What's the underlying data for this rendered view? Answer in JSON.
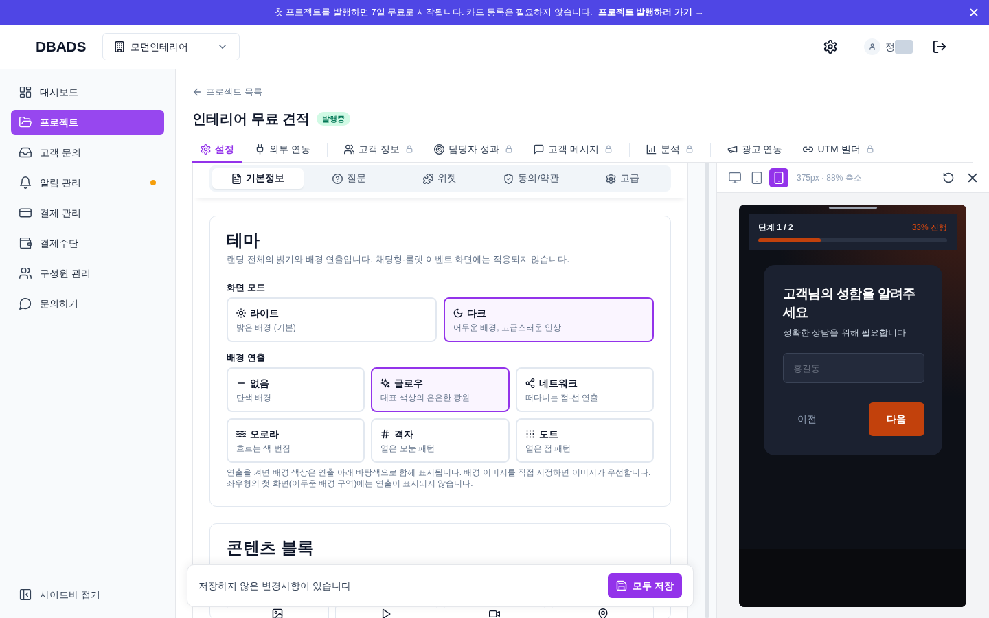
{
  "banner": {
    "message": "첫 프로젝트를 발행하면 7일 무료로 시작됩니다. 카드 등록은 필요하지 않습니다.",
    "link": "프로젝트 발행하러 가기 →"
  },
  "header": {
    "logo": "DBADS",
    "project_select": {
      "value": "모던인테리어"
    },
    "user": {
      "name": "정",
      "redacted": true
    }
  },
  "sidebar": {
    "items": [
      {
        "label": "대시보드",
        "selected": false,
        "notification_dot": false
      },
      {
        "label": "프로젝트",
        "selected": true,
        "notification_dot": false
      },
      {
        "label": "고객 문의",
        "selected": false,
        "notification_dot": false
      },
      {
        "label": "알림 관리",
        "selected": false,
        "notification_dot": true
      },
      {
        "label": "결제 관리",
        "selected": false,
        "notification_dot": false
      },
      {
        "label": "결제수단",
        "selected": false,
        "notification_dot": false
      },
      {
        "label": "구성원 관리",
        "selected": false,
        "notification_dot": false
      },
      {
        "label": "문의하기",
        "selected": false,
        "notification_dot": false
      }
    ],
    "collapse": "사이드바 접기"
  },
  "page": {
    "back_link": "프로젝트 목록",
    "title": "인테리어 무료 견적",
    "status_badge": "발행중"
  },
  "tabs": [
    {
      "label": "설정",
      "selected": true,
      "locked": false,
      "divider_after": false
    },
    {
      "label": "외부 연동",
      "selected": false,
      "locked": false,
      "divider_after": true
    },
    {
      "label": "고객 정보",
      "selected": false,
      "locked": true,
      "divider_after": false
    },
    {
      "label": "담당자 성과",
      "selected": false,
      "locked": true,
      "divider_after": false
    },
    {
      "label": "고객 메시지",
      "selected": false,
      "locked": true,
      "divider_after": true
    },
    {
      "label": "분석",
      "selected": false,
      "locked": true,
      "divider_after": true
    },
    {
      "label": "광고 연동",
      "selected": false,
      "locked": false,
      "divider_after": false
    },
    {
      "label": "UTM 빌더",
      "selected": false,
      "locked": true,
      "divider_after": false
    }
  ],
  "editor": {
    "subtabs": [
      {
        "label": "기본정보",
        "selected": true
      },
      {
        "label": "질문",
        "selected": false
      },
      {
        "label": "위젯",
        "selected": false
      },
      {
        "label": "동의/약관",
        "selected": false
      },
      {
        "label": "고급",
        "selected": false
      }
    ],
    "theme_card": {
      "title": "테마",
      "description": "랜딩 전체의 밝기와 배경 연출입니다. 채팅형·룰렛 이벤트 화면에는 적용되지 않습니다.",
      "mode_label": "화면 모드",
      "modes": [
        {
          "title": "라이트",
          "description": "밝은 배경 (기본)",
          "selected": false
        },
        {
          "title": "다크",
          "description": "어두운 배경, 고급스러운 인상",
          "selected": true
        }
      ],
      "effect_label": "배경 연출",
      "effects": [
        {
          "title": "없음",
          "description": "단색 배경",
          "selected": false
        },
        {
          "title": "글로우",
          "description": "대표 색상의 은은한 광원",
          "selected": true
        },
        {
          "title": "네트워크",
          "description": "떠다니는 점·선 연출",
          "selected": false
        },
        {
          "title": "오로라",
          "description": "흐르는 색 번짐",
          "selected": false
        },
        {
          "title": "격자",
          "description": "옅은 모눈 패턴",
          "selected": false
        },
        {
          "title": "도트",
          "description": "옅은 점 패턴",
          "selected": false
        }
      ],
      "note": "연출을 켜면 배경 색상은 연출 아래 바탕색으로 함께 표시됩니다. 배경 이미지를 직접 지정하면 이미지가 우선합니다. 좌우형의 첫 화면(어두운 배경 구역)에는 연출이 표시되지 않습니다."
    },
    "content_card": {
      "title": "콘텐츠 블록"
    }
  },
  "save_bar": {
    "message": "저장하지 않은 변경사항이 있습니다",
    "button": "모두 저장"
  },
  "preview": {
    "devices": [
      {
        "kind": "desktop",
        "selected": false
      },
      {
        "kind": "tablet",
        "selected": false
      },
      {
        "kind": "mobile",
        "selected": true
      }
    ],
    "size_label": "375px · 88% 축소",
    "form": {
      "step": "단계 1 / 2",
      "progress": "33% 진행",
      "level": 0.33,
      "title": "고객님의 성함을 알려주세요",
      "subtitle": "정확한 상담을 위해 필요합니다",
      "input": {
        "placeholder": "홍길동"
      },
      "prev_button": "이전",
      "next_button": "다음"
    }
  }
}
